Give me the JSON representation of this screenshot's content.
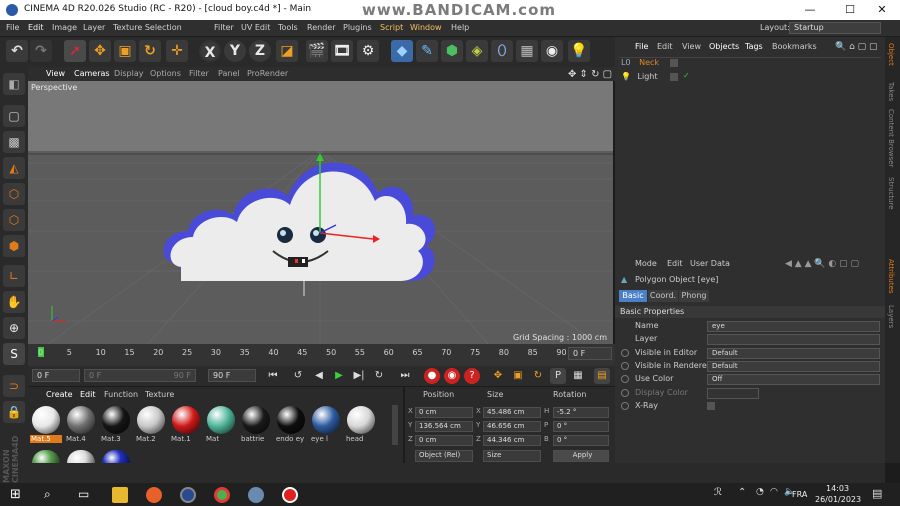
{
  "window": {
    "title": "CINEMA 4D R20.026 Studio (RC - R20) - [cloud boy.c4d *] - Main",
    "watermark": "www.BANDICAM.com",
    "controls": [
      "—",
      "☐",
      "✕"
    ]
  },
  "menubar": {
    "items": [
      "File",
      "Edit",
      "Image",
      "Layer",
      "Texture Selection",
      "Filter",
      "UV Edit",
      "Tools",
      "Render",
      "Plugins",
      "Script",
      "Window",
      "Help"
    ],
    "layout_label": "Layout:",
    "layout_value": "Startup"
  },
  "toolbar": {
    "buttons": [
      "undo",
      "redo",
      "live-selection",
      "move",
      "scale",
      "rotate",
      "recent",
      "x-axis",
      "y-axis",
      "z-axis",
      "coordinate-system",
      "render-view",
      "render-picture-viewer",
      "edit-render-settings",
      "cube",
      "pen",
      "subdivision",
      "extrude",
      "deformer",
      "scene",
      "camera",
      "light"
    ],
    "axis_labels": [
      "X",
      "Y",
      "Z"
    ]
  },
  "viewport": {
    "menu": [
      "View",
      "Cameras",
      "Display",
      "Options",
      "Filter",
      "Panel",
      "ProRender"
    ],
    "camera_label": "Perspective",
    "grid_spacing": "Grid Spacing : 1000 cm"
  },
  "timeline": {
    "ticks": [
      "0",
      "5",
      "10",
      "15",
      "20",
      "25",
      "30",
      "35",
      "40",
      "45",
      "50",
      "55",
      "60",
      "65",
      "70",
      "75",
      "80",
      "85",
      "90"
    ],
    "current_frame": "0 F",
    "start": "0 F",
    "min": "0 F",
    "max": "90 F",
    "end": "90 F"
  },
  "materials": {
    "menu": [
      "Create",
      "Edit",
      "Function",
      "Texture"
    ],
    "items": [
      {
        "name": "Mat.5",
        "color": "#e8e8e8",
        "selected": true
      },
      {
        "name": "Mat.4",
        "color": "#707070"
      },
      {
        "name": "Mat.3",
        "color": "#151515"
      },
      {
        "name": "Mat.2",
        "color": "#c8c8c8"
      },
      {
        "name": "Mat.1",
        "color": "#d01818"
      },
      {
        "name": "Mat",
        "color": "#4fb59a"
      },
      {
        "name": "battrie",
        "color": "#1a1a1a"
      },
      {
        "name": "endo ey",
        "color": "#0e0e0e"
      },
      {
        "name": "eye l",
        "color": "#2d5aa0"
      },
      {
        "name": "head",
        "color": "#d8d8d8"
      }
    ],
    "second_row": [
      "#5aa050",
      "#dddddd",
      "#2030c0"
    ]
  },
  "coordinates": {
    "headers": [
      "Position",
      "Size",
      "Rotation"
    ],
    "rows": [
      {
        "axis": "X",
        "pos": "0 cm",
        "size_axis": "X",
        "size": "45.486 cm",
        "rot_axis": "H",
        "rot": "-5.2 °"
      },
      {
        "axis": "Y",
        "pos": "136.564 cm",
        "size_axis": "Y",
        "size": "46.656 cm",
        "rot_axis": "P",
        "rot": "0 °"
      },
      {
        "axis": "Z",
        "pos": "0 cm",
        "size_axis": "Z",
        "size": "44.346 cm",
        "rot_axis": "B",
        "rot": "0 °"
      }
    ],
    "mode_select": "Object (Rel)",
    "size_select": "Size",
    "apply_label": "Apply"
  },
  "object_manager": {
    "menu": [
      "File",
      "Edit",
      "View",
      "Objects",
      "Tags",
      "Bookmarks"
    ],
    "objects": [
      {
        "name": "Neck",
        "color": "#e0872a"
      },
      {
        "name": "Light",
        "color": "#cccccc"
      }
    ]
  },
  "attributes": {
    "menu": [
      "Mode",
      "Edit",
      "User Data"
    ],
    "object_title": "Polygon Object [eye]",
    "tabs": [
      "Basic",
      "Coord.",
      "Phong"
    ],
    "section": "Basic Properties",
    "rows": [
      {
        "label": "Name",
        "value": "eye"
      },
      {
        "label": "Layer",
        "value": ""
      },
      {
        "label": "Visible in Editor",
        "value": "Default"
      },
      {
        "label": "Visible in Renderer",
        "value": "Default"
      },
      {
        "label": "Use Color",
        "value": "Off"
      },
      {
        "label": "Display Color",
        "value": ""
      },
      {
        "label": "X-Ray",
        "value": ""
      }
    ]
  },
  "side_tabs": [
    "Object",
    "Takes",
    "Content Browser",
    "Structure",
    "Attributes",
    "Layers"
  ],
  "taskbar": {
    "language": "FRA",
    "time": "14:03",
    "date": "26/01/2023"
  },
  "colors": {
    "accent_orange": "#e07b1c",
    "tab_active": "#4a80c8",
    "viewport_bg": "#6b6b6b",
    "cloud_outline": "#4a4ad8"
  }
}
